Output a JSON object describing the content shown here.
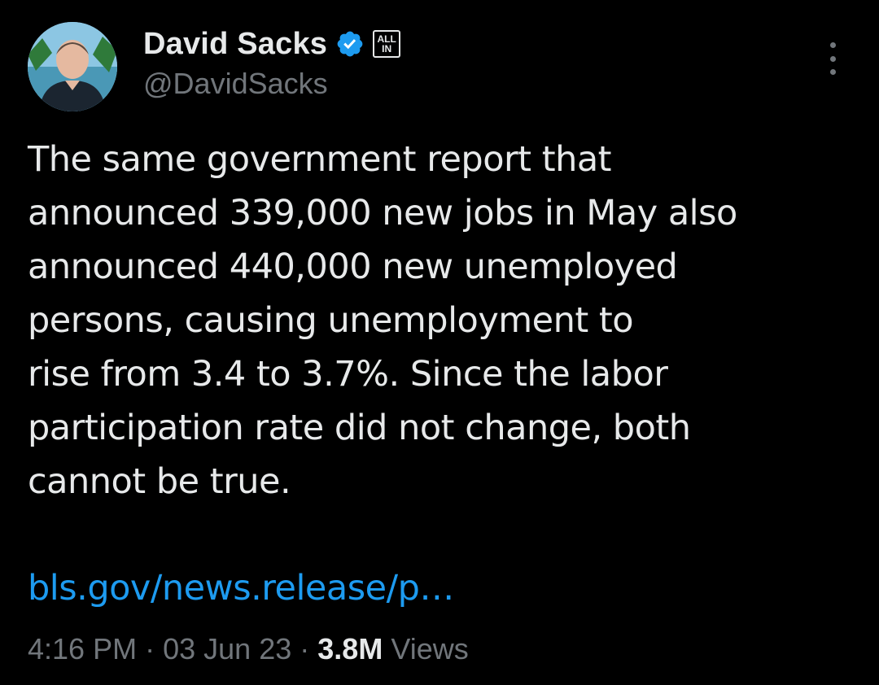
{
  "author": {
    "display_name": "David Sacks",
    "handle": "@DavidSacks",
    "verified": true,
    "affiliation_badge": [
      "ALL",
      "IN"
    ],
    "avatar": "profile-photo"
  },
  "tweet": {
    "text": "The same government report that\nannounced 339,000 new jobs in May also\nannounced 440,000 new unemployed\npersons, causing unemployment to\nrise from 3.4 to 3.7%. Since the labor\nparticipation rate did not change, both\ncannot be true.",
    "link": "bls.gov/news.release/p…"
  },
  "meta": {
    "time": "4:16 PM",
    "separator": "·",
    "date": "03 Jun 23",
    "views_count": "3.8M",
    "views_label": "Views"
  },
  "icons": {
    "verified": "verified-badge-icon",
    "more": "more-options-icon"
  },
  "colors": {
    "background": "#000000",
    "text": "#e7e9ea",
    "secondary": "#71767b",
    "link": "#1d9bf0"
  }
}
